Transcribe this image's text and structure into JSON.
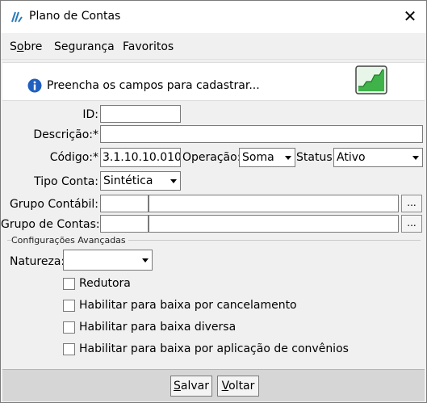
{
  "window": {
    "title": "Plano de Contas",
    "close_glyph": "✕"
  },
  "menu": [
    {
      "label": "Sobre",
      "mnemonic": "o"
    },
    {
      "label": "Segurança"
    },
    {
      "label": "Favoritos"
    }
  ],
  "banner": {
    "message": "Preencha os campos para cadastrar...",
    "info_icon": "info-icon",
    "chart_icon": "growth-chart-icon"
  },
  "form": {
    "id": {
      "label": "ID:",
      "value": ""
    },
    "descricao": {
      "label": "Descrição:*",
      "value": ""
    },
    "codigo": {
      "label": "Código:*",
      "value": "3.1.10.10.010."
    },
    "operacao": {
      "label": "Operação:",
      "value": "Soma"
    },
    "status": {
      "label": "Status:",
      "value": "Ativo"
    },
    "tipo_conta": {
      "label": "Tipo Conta:",
      "value": "Sintética"
    },
    "grupo_contabil": {
      "label": "Grupo Contábil:",
      "code": "",
      "desc": "",
      "button": "..."
    },
    "grupo_contas": {
      "label": "Grupo de Contas:",
      "code": "",
      "desc": "",
      "button": "..."
    }
  },
  "advanced": {
    "title": "Configurações Avançadas",
    "natureza": {
      "label": "Natureza:",
      "value": ""
    },
    "checks": [
      {
        "label": "Redutora",
        "checked": false
      },
      {
        "label": "Habilitar para baixa por cancelamento",
        "checked": false
      },
      {
        "label": "Habilitar para baixa diversa",
        "checked": false
      },
      {
        "label": "Habilitar para baixa por aplicação de convênios",
        "checked": false
      }
    ]
  },
  "footer": {
    "save": {
      "label": "Salvar",
      "mnemonic": "S"
    },
    "back": {
      "label": "Voltar",
      "mnemonic": "V"
    }
  },
  "colors": {
    "accent_green": "#3fb24a",
    "info_blue": "#1f5fbf",
    "footer_bg": "#d6d6d6"
  }
}
